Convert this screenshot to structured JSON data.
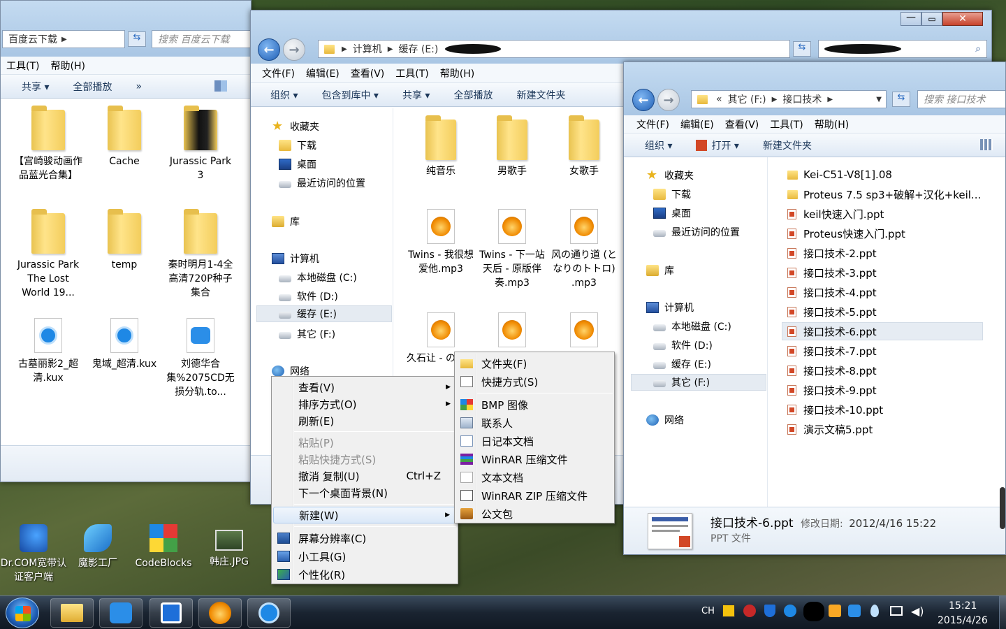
{
  "left_window": {
    "address_crumb": "百度云下载",
    "search_placeholder": "搜索 百度云下载",
    "menu": [
      "工具(T)",
      "帮助(H)"
    ],
    "commands": [
      "共享 ▾",
      "全部播放",
      "»"
    ],
    "tiles": [
      {
        "label": "【宫崎骏动画作品蓝光合集】",
        "type": "folder"
      },
      {
        "label": "Cache",
        "type": "folder"
      },
      {
        "label": "Jurassic Park 3",
        "type": "folder"
      },
      {
        "label": "Jurassic Park The Lost World 19...",
        "type": "folder"
      },
      {
        "label": "temp",
        "type": "folder"
      },
      {
        "label": "秦时明月1-4全高清720P种子集合",
        "type": "folder"
      },
      {
        "label": "古墓丽影2_超清.kux",
        "type": "kux"
      },
      {
        "label": "鬼域_超清.kux",
        "type": "kux"
      },
      {
        "label": "刘德华合集%2075CD无损分轨.to...",
        "type": "baidu"
      }
    ]
  },
  "middle_window": {
    "address": [
      "计算机",
      "缓存 (E:)"
    ],
    "menu": [
      "文件(F)",
      "编辑(E)",
      "查看(V)",
      "工具(T)",
      "帮助(H)"
    ],
    "commands": [
      "组织 ▾",
      "包含到库中 ▾",
      "共享 ▾",
      "全部播放",
      "新建文件夹"
    ],
    "nav": {
      "favorites": "收藏夹",
      "downloads": "下载",
      "desktop": "桌面",
      "recent": "最近访问的位置",
      "libraries": "库",
      "computer": "计算机",
      "drive_c": "本地磁盘 (C:)",
      "drive_d": "软件 (D:)",
      "drive_e": "缓存 (E:)",
      "drive_f": "其它 (F:)",
      "network": "网络"
    },
    "tiles": [
      {
        "label": "纯音乐",
        "type": "folder"
      },
      {
        "label": "男歌手",
        "type": "folder"
      },
      {
        "label": "女歌手",
        "type": "folder"
      },
      {
        "label": "Twins - 我很想爱他.mp3",
        "type": "mp3"
      },
      {
        "label": "Twins - 下一站天后 - 原版伴奏.mp3",
        "type": "mp3"
      },
      {
        "label": "风の通り道 (となりのトトロ) .mp3",
        "type": "mp3"
      },
      {
        "label": "久石让 - の夏へ -",
        "type": "mp3"
      }
    ]
  },
  "right_window": {
    "address": [
      "«",
      "其它 (F:)",
      "接口技术"
    ],
    "search_placeholder": "搜索 接口技术",
    "menu": [
      "文件(F)",
      "编辑(E)",
      "查看(V)",
      "工具(T)",
      "帮助(H)"
    ],
    "commands": [
      "组织 ▾",
      "打开 ▾",
      "新建文件夹"
    ],
    "nav": {
      "favorites": "收藏夹",
      "downloads": "下载",
      "desktop": "桌面",
      "recent": "最近访问的位置",
      "libraries": "库",
      "computer": "计算机",
      "drive_c": "本地磁盘 (C:)",
      "drive_d": "软件 (D:)",
      "drive_e": "缓存 (E:)",
      "drive_f": "其它 (F:)",
      "network": "网络"
    },
    "files": [
      {
        "name": "Kei-C51-V8[1].08",
        "type": "folder"
      },
      {
        "name": "Proteus 7.5 sp3+破解+汉化+keil...",
        "type": "folder"
      },
      {
        "name": "keil快速入门.ppt",
        "type": "ppt"
      },
      {
        "name": "Proteus快速入门.ppt",
        "type": "ppt"
      },
      {
        "name": "接口技术-2.ppt",
        "type": "ppt"
      },
      {
        "name": "接口技术-3.ppt",
        "type": "ppt"
      },
      {
        "name": "接口技术-4.ppt",
        "type": "ppt"
      },
      {
        "name": "接口技术-5.ppt",
        "type": "ppt"
      },
      {
        "name": "接口技术-6.ppt",
        "type": "ppt",
        "selected": true
      },
      {
        "name": "接口技术-7.ppt",
        "type": "ppt"
      },
      {
        "name": "接口技术-8.ppt",
        "type": "ppt"
      },
      {
        "name": "接口技术-9.ppt",
        "type": "ppt"
      },
      {
        "name": "接口技术-10.ppt",
        "type": "ppt"
      },
      {
        "name": "演示文稿5.ppt",
        "type": "ppt"
      }
    ],
    "details": {
      "name": "接口技术-6.ppt",
      "modified_label": "修改日期:",
      "modified": "2012/4/16 15:22",
      "type": "PPT 文件"
    }
  },
  "context_menu": {
    "view": "查看(V)",
    "sort": "排序方式(O)",
    "refresh": "刷新(E)",
    "paste": "粘贴(P)",
    "paste_shortcut": "粘贴快捷方式(S)",
    "undo_copy": "撤消 复制(U)",
    "undo_shortcut": "Ctrl+Z",
    "next_bg": "下一个桌面背景(N)",
    "new": "新建(W)",
    "resolution": "屏幕分辨率(C)",
    "gadgets": "小工具(G)",
    "personalize": "个性化(R)"
  },
  "new_submenu": {
    "folder": "文件夹(F)",
    "shortcut": "快捷方式(S)",
    "bmp": "BMP 图像",
    "contact": "联系人",
    "journal": "日记本文档",
    "winrar": "WinRAR 压缩文件",
    "text": "文本文档",
    "winrar_zip": "WinRAR ZIP 压缩文件",
    "briefcase": "公文包"
  },
  "desktop_icons": [
    {
      "label": "Dr.COM宽带认证客户端",
      "icon": "network-client-icon"
    },
    {
      "label": "魔影工厂",
      "icon": "format-factory-icon"
    },
    {
      "label": "CodeBlocks",
      "icon": "codeblocks-icon"
    },
    {
      "label": "韩庄.JPG",
      "icon": "image-file-icon"
    }
  ],
  "tray": {
    "lang": "CH",
    "time": "15:21",
    "date": "2015/4/26"
  },
  "colors": {
    "accent": "#1f5fb5",
    "selection": "#e5ebf2",
    "menu_highlight": "#dbe8f8"
  }
}
